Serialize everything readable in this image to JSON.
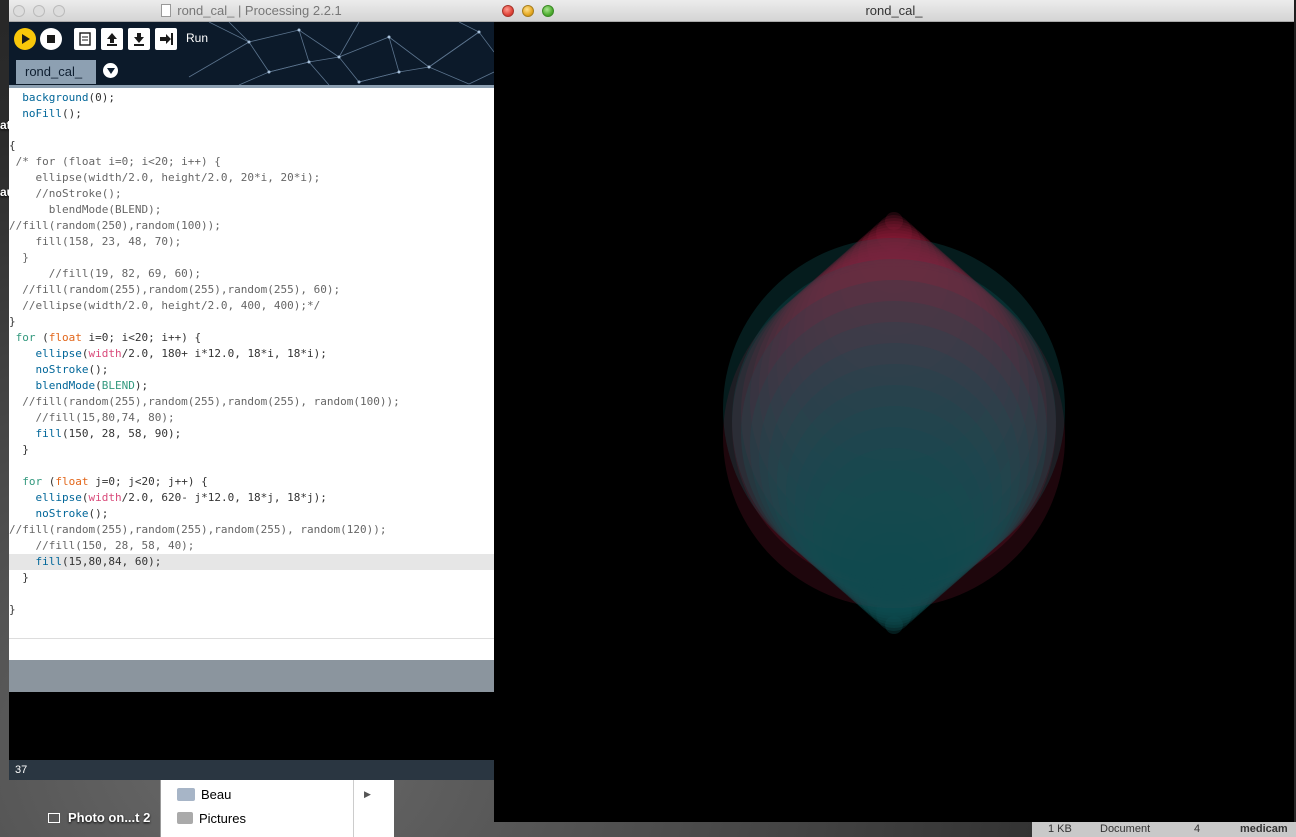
{
  "editor": {
    "title": "rond_cal_ | Processing 2.2.1",
    "run_label": "Run",
    "tab_label": "rond_cal_",
    "line_number": "37",
    "code_lines": [
      "  background(0);",
      "  noFill();",
      "",
      "{",
      " /* for (float i=0; i<20; i++) {",
      "    ellipse(width/2.0, height/2.0, 20*i, 20*i);",
      "    //noStroke();",
      "      blendMode(BLEND);",
      "//fill(random(250),random(100));",
      "    fill(158, 23, 48, 70);",
      "  }",
      "      //fill(19, 82, 69, 60);",
      "  //fill(random(255),random(255),random(255), 60);",
      "  //ellipse(width/2.0, height/2.0, 400, 400);*/",
      "}",
      " for (float i=0; i<20; i++) {",
      "    ellipse(width/2.0, 180+ i*12.0, 18*i, 18*i);",
      "    noStroke();",
      "    blendMode(BLEND);",
      "  //fill(random(255),random(255),random(255), random(100));",
      "    //fill(15,80,74, 80);",
      "    fill(150, 28, 58, 90);",
      "  }",
      "",
      "  for (float j=0; j<20; j++) {",
      "    ellipse(width/2.0, 620- j*12.0, 18*j, 18*j);",
      "    noStroke();",
      "//fill(random(255),random(255),random(255), random(120));",
      "    //fill(150, 28, 58, 40);",
      "    fill(15,80,84, 60);",
      "  }",
      "",
      "}"
    ]
  },
  "sketch": {
    "title": "rond_cal_"
  },
  "finder": {
    "items": [
      "Beau",
      "Pictures"
    ]
  },
  "desktop": {
    "photo_label": "Photo on...t 2",
    "status_size": "1 KB",
    "status_kind": "Document",
    "status_count": "4",
    "status_name": "medicam"
  },
  "colors": {
    "run_button": "#f9c70a",
    "tab_bg": "#8da0b2",
    "sketch_red": "#961c3a",
    "sketch_teal": "#0f5054"
  }
}
